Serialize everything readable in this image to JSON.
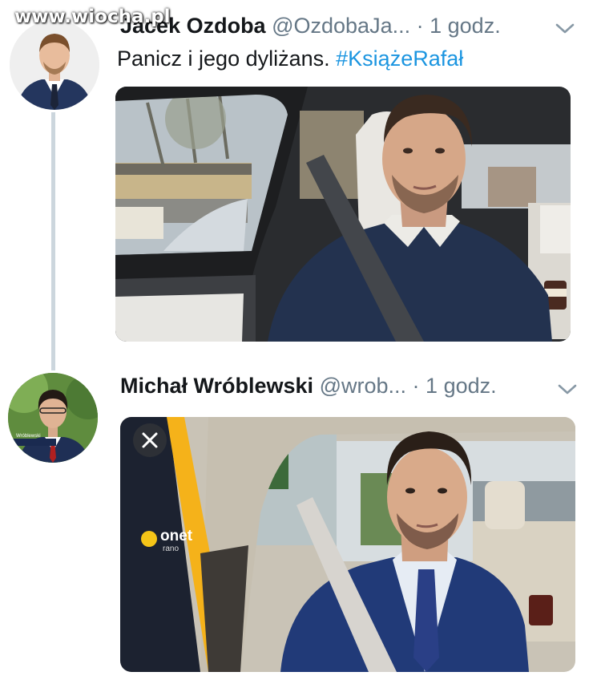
{
  "watermark": "www.wiocha.pl",
  "tweets": [
    {
      "name": "Jacek Ozdoba",
      "handle": "@OzdobaJa...",
      "separator": "·",
      "time": "1 godz.",
      "text": "Panicz i jego dyliżans.",
      "hashtag": "#KsiążeRafał",
      "avatar_icon": "profile-photo"
    },
    {
      "name": "Michał Wróblewski",
      "handle": "@wrob...",
      "separator": "·",
      "time": "1 godz.",
      "avatar_caption": "Wróblewski",
      "avatar_icon": "profile-photo"
    }
  ],
  "video_overlay": {
    "brand": "onet",
    "brand_sub": "rano",
    "close_icon": "close-icon",
    "brand_color": "#f5c518"
  },
  "colors": {
    "hashtag": "#1b95e0",
    "secondary_text": "#657786",
    "thread_line": "#ccd6dd"
  }
}
